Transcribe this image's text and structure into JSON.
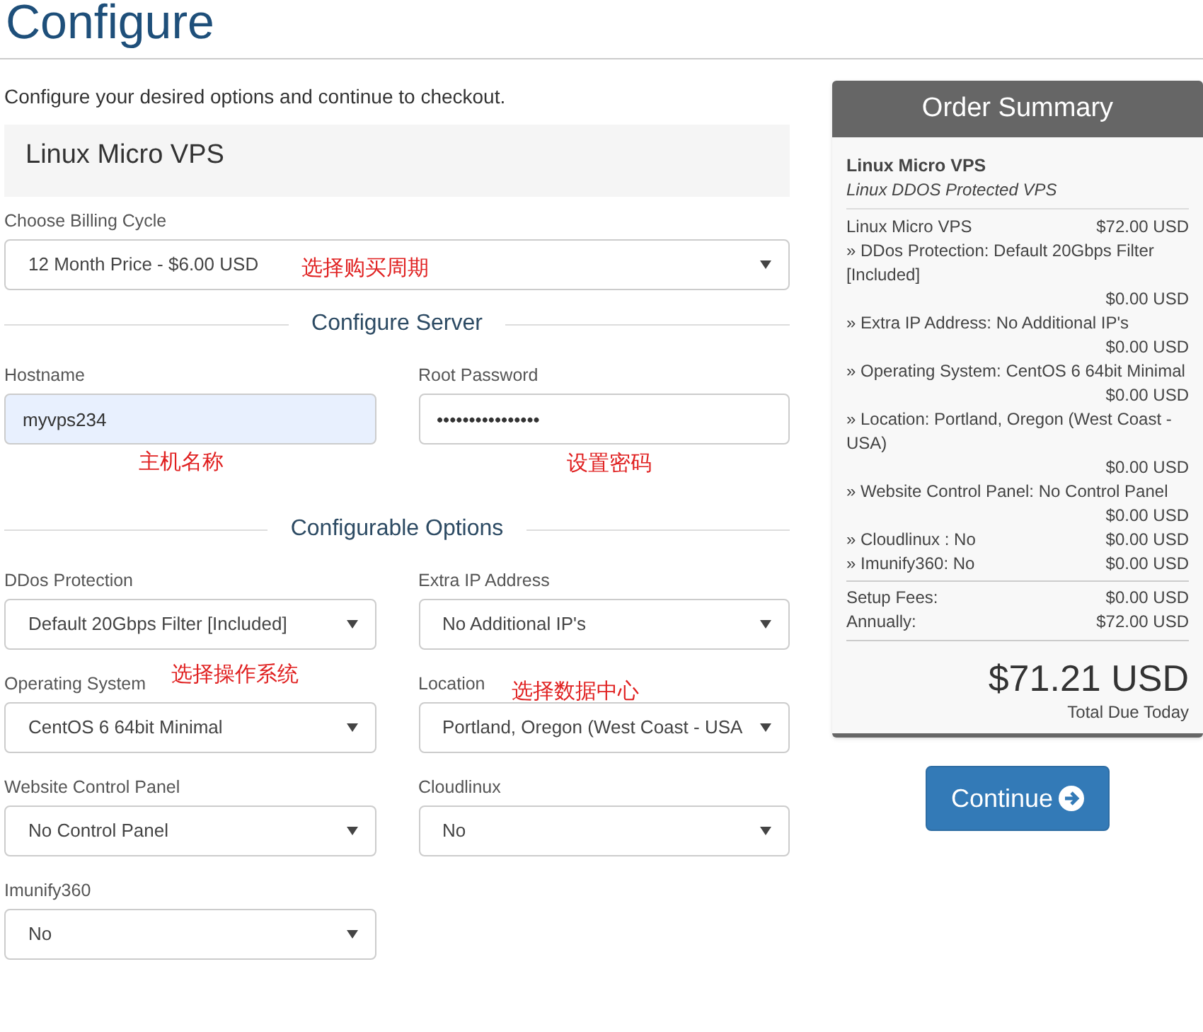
{
  "page_title": "Configure",
  "intro": "Configure your desired options and continue to checkout.",
  "product": {
    "name": "Linux Micro VPS"
  },
  "billing": {
    "label": "Choose Billing Cycle",
    "value": "12 Month Price - $6.00 USD",
    "annotation": "选择购买周期"
  },
  "server": {
    "heading": "Configure Server",
    "fields": [
      {
        "kind": "text",
        "label": "Hostname",
        "value": "myvps234",
        "annotation": "主机名称"
      },
      {
        "kind": "password",
        "label": "Root Password",
        "value": "••••••••••••••••",
        "annotation": "设置密码"
      }
    ]
  },
  "options": {
    "heading": "Configurable Options",
    "fields": [
      {
        "label": "DDos Protection",
        "value": "Default 20Gbps Filter [Included]"
      },
      {
        "label": "Extra IP Address",
        "value": "No Additional IP's"
      },
      {
        "label": "Operating System",
        "value": "CentOS 6 64bit Minimal",
        "annotation": "选择操作系统"
      },
      {
        "label": "Location",
        "value": "Portland, Oregon (West Coast - USA",
        "annotation": "选择数据中心"
      },
      {
        "label": "Website Control Panel",
        "value": "No Control Panel"
      },
      {
        "label": "Cloudlinux",
        "value": "No"
      },
      {
        "label": "Imunify360",
        "value": "No"
      }
    ]
  },
  "summary": {
    "title": "Order Summary",
    "product": "Linux Micro VPS",
    "group": "Linux DDOS Protected VPS",
    "items": [
      {
        "name": "Linux Micro VPS",
        "price": "$72.00 USD"
      },
      {
        "name": "» DDos Protection: Default 20Gbps Filter [Included]",
        "price": "$0.00 USD"
      },
      {
        "name": "» Extra IP Address: No Additional IP's",
        "price": "$0.00 USD"
      },
      {
        "name": "» Operating System: CentOS 6 64bit Minimal",
        "price": "$0.00 USD"
      },
      {
        "name": "» Location: Portland, Oregon (West Coast - USA)",
        "price": "$0.00 USD"
      },
      {
        "name": "» Website Control Panel: No Control Panel",
        "price": "$0.00 USD"
      },
      {
        "name": "» Cloudlinux : No",
        "price": "$0.00 USD"
      },
      {
        "name": "» Imunify360: No",
        "price": "$0.00 USD"
      }
    ],
    "totals": [
      {
        "name": "Setup Fees:",
        "price": "$0.00 USD"
      },
      {
        "name": "Annually:",
        "price": "$72.00 USD"
      }
    ],
    "total": "$71.21 USD",
    "total_label": "Total Due Today"
  },
  "continue_button": "Continue"
}
